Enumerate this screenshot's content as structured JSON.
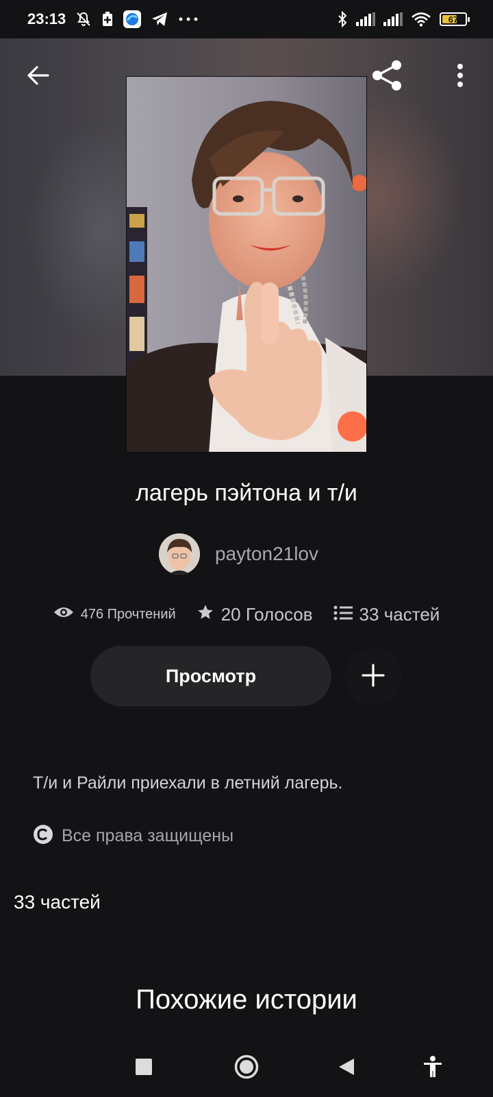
{
  "status_bar": {
    "time": "23:13",
    "battery_level": "67",
    "battery_fraction": 0.67,
    "battery_color": "#e8c23a",
    "left_icons": [
      "notifications-muted-icon",
      "battery-saver-icon",
      "browser-app-icon",
      "telegram-icon",
      "more-dots-icon"
    ],
    "right_icons": [
      "bluetooth-icon",
      "signal-icon",
      "signal-icon",
      "wifi-icon",
      "battery-icon"
    ]
  },
  "header": {
    "back_icon": "arrow-left-icon",
    "share_icon": "share-icon",
    "more_icon": "more-vertical-icon"
  },
  "story": {
    "title": "лагерь пэйтона и т/и",
    "author": "payton21lov",
    "stats": {
      "reads": "476 Прочтений",
      "votes": "20 Голосов",
      "parts": "33 частей"
    },
    "read_button": "Просмотр",
    "add_icon": "plus-icon",
    "description": "Т/и и Райли приехали в летний лагерь.",
    "copyright": "Все права защищены"
  },
  "sections": {
    "parts_heading": "33 частей",
    "similar_heading": "Похожие истории"
  },
  "nav_bar": {
    "icons": [
      "recent-apps-square-icon",
      "home-circle-icon",
      "back-triangle-icon",
      "accessibility-icon"
    ]
  },
  "colors": {
    "background": "#131215",
    "button_bg": "#252427",
    "secondary_text": "#a9a8ad"
  }
}
